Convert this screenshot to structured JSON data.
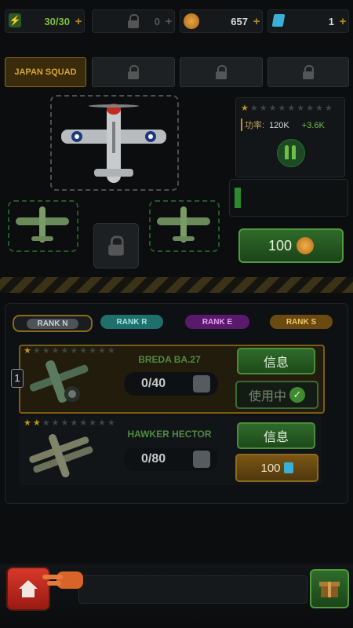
{
  "resources": {
    "energy": "30/30",
    "locked": "0",
    "coins": "657",
    "gems": "1",
    "plus": "+"
  },
  "tabs": [
    {
      "label": "JAPAN SQUAD",
      "locked": false
    },
    {
      "label": "",
      "locked": true
    },
    {
      "label": "",
      "locked": true
    },
    {
      "label": "",
      "locked": true
    }
  ],
  "power": {
    "label": "功率:",
    "value": "120K",
    "delta": "+3.6K",
    "stars_filled": 1,
    "stars_total": 10
  },
  "upgrade_cost": "100",
  "ranks": [
    {
      "label": "RANK N",
      "color": "#8a8f93",
      "selected": true
    },
    {
      "label": "RANK R",
      "color": "#3fb3b0"
    },
    {
      "label": "RANK E",
      "color": "#b43fcf"
    },
    {
      "label": "RANK S",
      "color": "#d39a24"
    }
  ],
  "planes": [
    {
      "name": "BREDA BA.27",
      "progress": "0/40",
      "stars_filled": 1,
      "stars_total": 10,
      "level_badge": "1",
      "info_label": "信息",
      "action_label": "使用中",
      "in_use": true
    },
    {
      "name": "HAWKER HECTOR",
      "progress": "0/80",
      "stars_filled": 2,
      "stars_total": 10,
      "info_label": "信息",
      "action_label": "100",
      "in_use": false
    }
  ],
  "colors": {
    "accent_gold": "#d8a437",
    "green": "#4f9b3e",
    "home_red": "#c8261c"
  }
}
